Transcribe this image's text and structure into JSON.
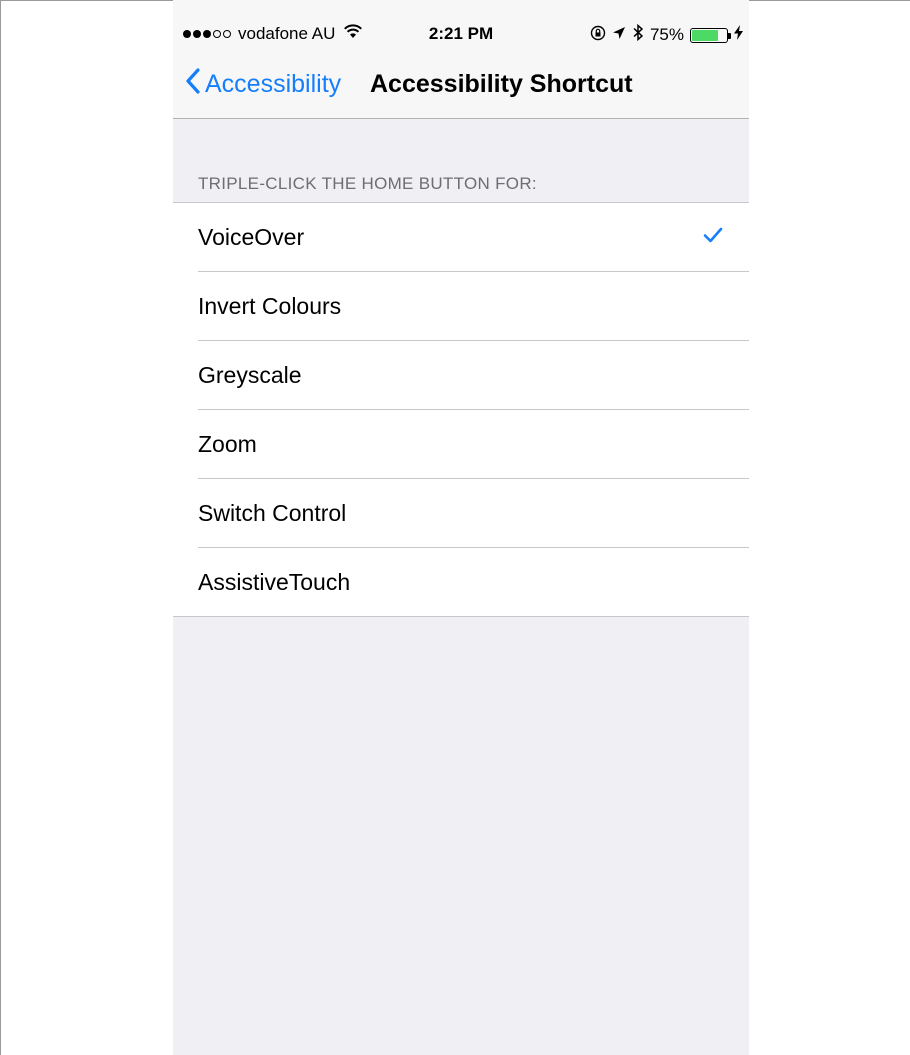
{
  "status_bar": {
    "carrier": "vodafone AU",
    "time": "2:21 PM",
    "battery": "75%",
    "battery_level": 0.75,
    "signal_bars_filled": 3,
    "signal_bars_total": 5,
    "icons": [
      "wifi-icon",
      "orientation-lock-icon",
      "location-icon",
      "bluetooth-icon",
      "battery-icon",
      "charging-icon"
    ]
  },
  "nav": {
    "back_label": "Accessibility",
    "title": "Accessibility Shortcut"
  },
  "section": {
    "header": "TRIPLE-CLICK THE HOME BUTTON FOR:"
  },
  "options": [
    {
      "label": "VoiceOver",
      "checked": true
    },
    {
      "label": "Invert Colours",
      "checked": false
    },
    {
      "label": "Greyscale",
      "checked": false
    },
    {
      "label": "Zoom",
      "checked": false
    },
    {
      "label": "Switch Control",
      "checked": false
    },
    {
      "label": "AssistiveTouch",
      "checked": false
    }
  ],
  "colors": {
    "accent": "#157efb",
    "battery_fill": "#4cd964",
    "background": "#efeff4",
    "header_text": "#6d6d72"
  }
}
